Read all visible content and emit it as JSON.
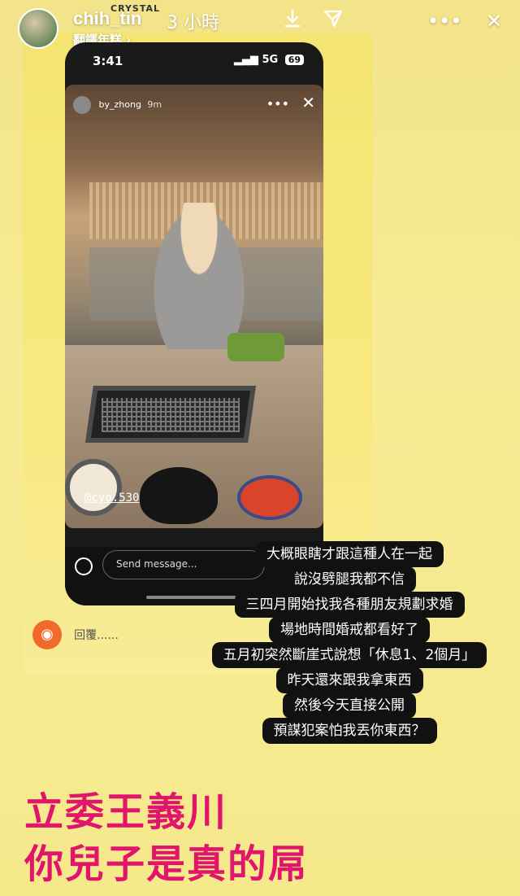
{
  "header": {
    "username": "chih_tin",
    "time_ago": "3 小時",
    "music_label": "CRYSTAL",
    "translate_label": "翻譯年糕 ›",
    "more_label": "•••",
    "close_label": "✕"
  },
  "embedded": {
    "status_time": "3:41",
    "signal": "5G",
    "battery": "69",
    "story_user": "by_zhong",
    "story_age": "9m",
    "mention": "@cyo.530",
    "message_placeholder": "Send message..."
  },
  "reply": {
    "label": "回覆......"
  },
  "caption_lines": [
    "大概眼瞎才跟這種人在一起",
    "說沒劈腿我都不信",
    "三四月開始找我各種朋友規劃求婚",
    "場地時間婚戒都看好了",
    "五月初突然斷崖式說想「休息1、2個月」",
    "昨天還來跟我拿東西",
    "然後今天直接公開",
    "預謀犯案怕我丟你東西？"
  ],
  "headline": {
    "line1": "立委王義川",
    "line2": "你兒子是真的屌"
  },
  "colors": {
    "background": "#f6e98a",
    "headline": "#e0156b",
    "reply_camera": "#f26a2b"
  }
}
